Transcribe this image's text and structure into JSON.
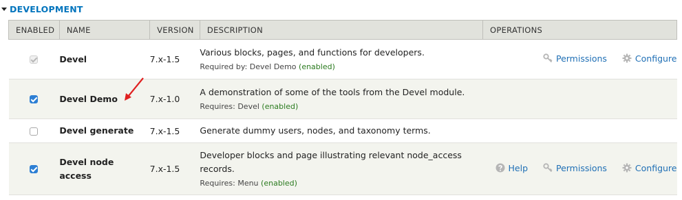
{
  "fieldset": {
    "title": "DEVELOPMENT"
  },
  "table": {
    "headers": [
      "ENABLED",
      "NAME",
      "VERSION",
      "DESCRIPTION",
      "OPERATIONS"
    ],
    "rows": [
      {
        "name": "Devel",
        "version": "7.x-1.5",
        "description": "Various blocks, pages, and functions for developers.",
        "sub_label": "Required by: Devel Demo",
        "sub_status": "(enabled)",
        "checkbox": "checked-disabled",
        "ops": {
          "help": "",
          "permissions": "Permissions",
          "configure": "Configure"
        }
      },
      {
        "name": "Devel Demo",
        "version": "7.x-1.0",
        "description": "A demonstration of some of the tools from the Devel module.",
        "sub_label": "Requires: Devel",
        "sub_status": "(enabled)",
        "checkbox": "checked",
        "ops": {}
      },
      {
        "name": "Devel generate",
        "version": "7.x-1.5",
        "description": "Generate dummy users, nodes, and taxonomy terms.",
        "checkbox": "unchecked",
        "ops": {}
      },
      {
        "name_line1": "Devel node",
        "name_line2": "access",
        "version": "7.x-1.5",
        "description_line1": "Developer blocks and page illustrating relevant node_access",
        "description_line2": "records.",
        "sub_label": "Requires: Menu",
        "sub_status": "(enabled)",
        "checkbox": "checked",
        "ops": {
          "help": "Help",
          "permissions": "Permissions",
          "configure": "Configure"
        }
      }
    ]
  },
  "colors": {
    "link": "#1f6fb5",
    "enabled_status": "#2a7a1e",
    "annotation_arrow": "#e02020",
    "header_bg": "#e1e2dc"
  }
}
